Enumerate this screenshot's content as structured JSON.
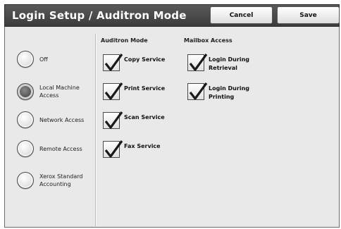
{
  "header": {
    "title": "Login Setup / Auditron Mode",
    "cancel_label": "Cancel",
    "save_label": "Save"
  },
  "login_modes": [
    {
      "label": "Off",
      "selected": false
    },
    {
      "label": "Local Machine Access",
      "selected": true
    },
    {
      "label": "Network Access",
      "selected": false
    },
    {
      "label": "Remote Access",
      "selected": false
    },
    {
      "label": "Xerox Standard Accounting",
      "selected": false
    }
  ],
  "auditron": {
    "header": "Auditron Mode",
    "items": [
      {
        "label": "Copy Service",
        "checked": true
      },
      {
        "label": "Print Service",
        "checked": true
      },
      {
        "label": "Scan Service",
        "checked": true
      },
      {
        "label": "Fax Service",
        "checked": true
      }
    ]
  },
  "mailbox": {
    "header": "Mailbox Access",
    "items": [
      {
        "label": "Login During Retrieval",
        "checked": true
      },
      {
        "label": "Login During Printing",
        "checked": true
      }
    ]
  },
  "colors": {
    "titlebar": "#444444",
    "panel": "#e9e9e9",
    "checkmark": "#1a1a1a"
  }
}
